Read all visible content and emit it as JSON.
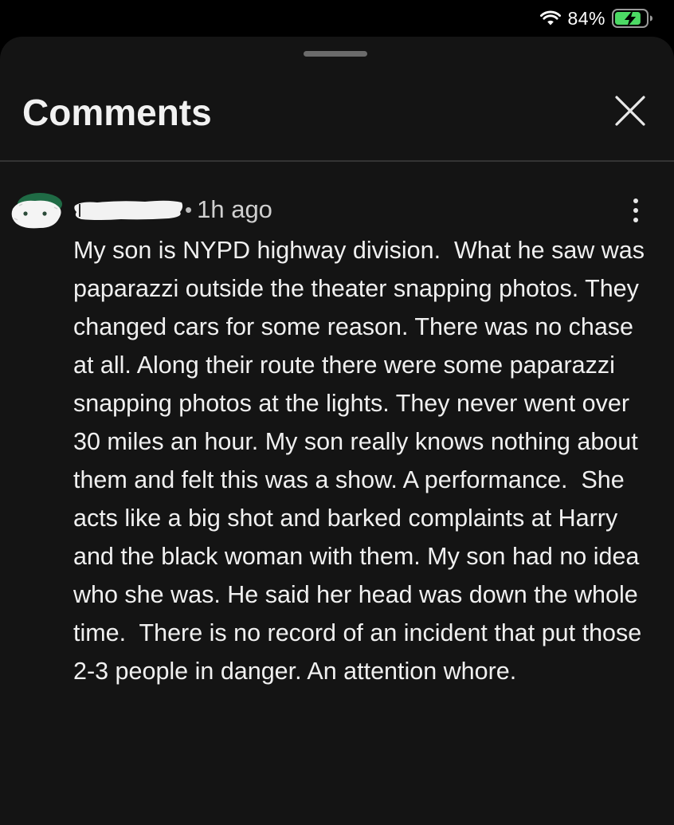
{
  "status_bar": {
    "battery_percent": "84%",
    "icons": [
      "wifi-icon",
      "battery-charging-icon"
    ],
    "battery_fill_fraction": 0.84,
    "battery_color": "#4cd964"
  },
  "sheet": {
    "title": "Comments",
    "close_icon": "close-icon"
  },
  "comment": {
    "author": "",
    "timestamp": "1h ago",
    "separator": "•",
    "menu_icon": "more-vertical-icon",
    "body": "My son is NYPD highway division.  What he saw was paparazzi outside the theater snapping photos. They changed cars for some reason. There was no chase at all. Along their route there were some paparazzi snapping photos at the lights. They never went over 30 miles an hour. My son really knows nothing about them and felt this was a show. A performance.  She acts like a big shot and barked complaints at Harry and the black woman with them. My son had no idea who she was. He said her head was down the whole time.  There is no record of an incident that put those 2-3 people in danger. An attention whore."
  },
  "colors": {
    "background": "#000000",
    "sheet": "#141414",
    "text": "#f0f0f0",
    "muted": "#d0d0d0",
    "avatar_accent": "#1f6b45"
  }
}
